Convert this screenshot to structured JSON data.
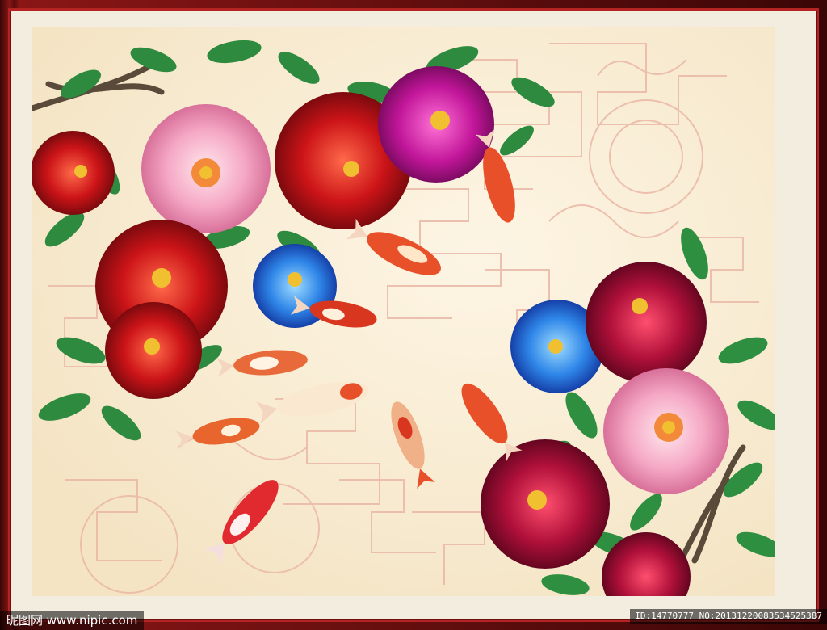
{
  "watermark": {
    "site": "昵图网 www.nipic.com",
    "id_text": "ID:14770777 NO:20131220083534525387"
  },
  "colors": {
    "frame": "#7a1212",
    "background": "#f8ecd2",
    "pattern": "#eab8a6",
    "red_peony": "#c8141a",
    "pink_peony": "#f4b6cc",
    "magenta_peony": "#c2169a",
    "blue_peony": "#2f6fe0",
    "crimson_peony": "#b0103a",
    "leaf": "#2e8a3e",
    "koi": "#e8502a"
  },
  "scene": {
    "subject": "painting",
    "icons": [
      "peony-flower",
      "koi-fish",
      "leaf",
      "branch",
      "lattice-pattern"
    ]
  }
}
